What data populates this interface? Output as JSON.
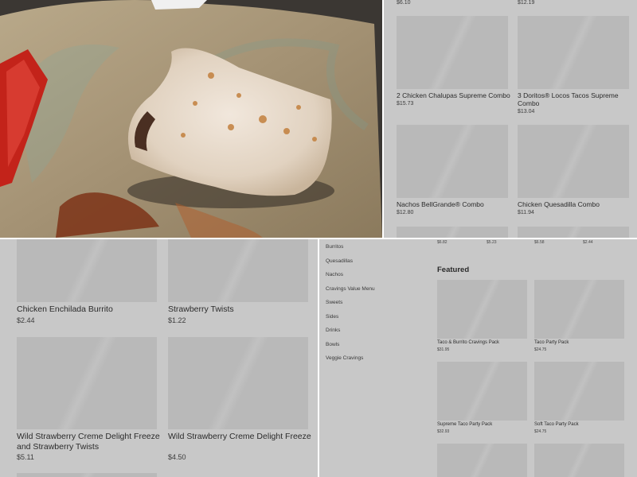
{
  "photo": {
    "alt_icon": "food-photo"
  },
  "top_right": {
    "top_prices": [
      "$6.10",
      "$12.19"
    ],
    "cards": [
      {
        "name": "2 Chicken Chalupas Supreme Combo",
        "price": "$15.73"
      },
      {
        "name": "3 Doritos® Locos Tacos Supreme Combo",
        "price": "$13.04"
      },
      {
        "name": "Nachos BellGrande® Combo",
        "price": "$12.80"
      },
      {
        "name": "Chicken Quesadilla Combo",
        "price": "$11.94"
      }
    ]
  },
  "bottom_left": {
    "cards": [
      {
        "name": "Chicken Enchilada Burrito",
        "price": "$2.44"
      },
      {
        "name": "Strawberry Twists",
        "price": "$1.22"
      },
      {
        "name": "Wild Strawberry Creme Delight Freeze and Strawberry Twists",
        "price": "$5.11"
      },
      {
        "name": "Wild Strawberry Creme Delight Freeze",
        "price": "$4.50"
      }
    ]
  },
  "bottom_right": {
    "top_prices": [
      "$6.82",
      "$5.23",
      "$6.58",
      "$2.44"
    ],
    "nav": [
      "Burritos",
      "Quesadillas",
      "Nachos",
      "Cravings Value Menu",
      "Sweets",
      "Sides",
      "Drinks",
      "Bowls",
      "Veggie Cravings"
    ],
    "section_title": "Featured",
    "cards": [
      {
        "name": "Taco & Burrito Cravings Pack",
        "price": "$31.95"
      },
      {
        "name": "Taco Party Pack",
        "price": "$24.75"
      },
      {
        "name": "Supreme Taco Party Pack",
        "price": "$32.93"
      },
      {
        "name": "Soft Taco Party Pack",
        "price": "$24.75"
      }
    ]
  }
}
